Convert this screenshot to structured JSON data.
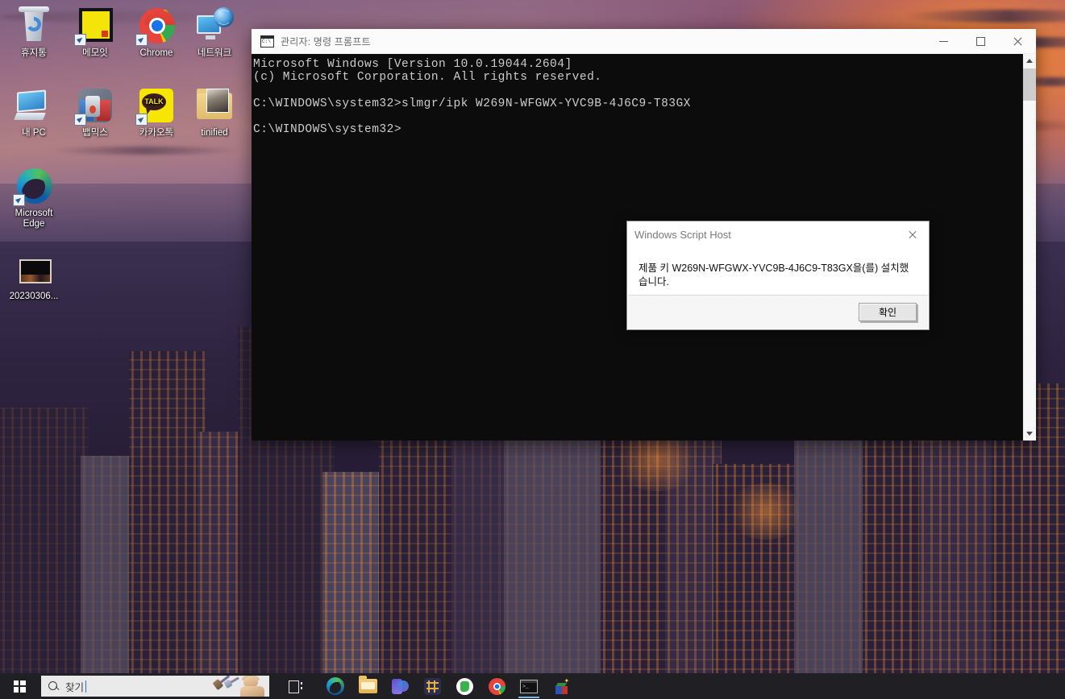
{
  "desktop": {
    "icons": [
      {
        "label": "휴지통",
        "icon": "recycle-bin-icon",
        "shortcut": false
      },
      {
        "label": "메모잇",
        "icon": "memoit-note-icon",
        "shortcut": true
      },
      {
        "label": "Chrome",
        "icon": "chrome-icon",
        "shortcut": true
      },
      {
        "label": "네트워크",
        "icon": "network-icon",
        "shortcut": false
      },
      {
        "label": "내 PC",
        "icon": "this-pc-icon",
        "shortcut": false
      },
      {
        "label": "뱁믹스",
        "icon": "vapmix-icon",
        "shortcut": true
      },
      {
        "label": "카카오톡",
        "icon": "kakaotalk-icon",
        "shortcut": true
      },
      {
        "label": "tinified",
        "icon": "folder-icon",
        "shortcut": false
      },
      {
        "label": "Microsoft Edge",
        "icon": "microsoft-edge-icon",
        "shortcut": true
      },
      {
        "label": "20230306...",
        "icon": "video-file-icon",
        "shortcut": false
      }
    ]
  },
  "console_window": {
    "title": "관리자: 명령 프롬프트",
    "icon": "command-prompt-icon",
    "content": "Microsoft Windows [Version 10.0.19044.2604]\n(c) Microsoft Corporation. All rights reserved.\n\nC:\\WINDOWS\\system32>slmgr/ipk W269N-WFGWX-YVC9B-4J6C9-T83GX\n\nC:\\WINDOWS\\system32>",
    "controls": {
      "minimize": "minimize-button",
      "maximize": "maximize-button",
      "close": "close-button"
    },
    "scrollbar": {
      "up": "scroll-up-arrow",
      "down": "scroll-down-arrow"
    }
  },
  "dialog": {
    "title": "Windows Script Host",
    "message": "제품 키 W269N-WFGWX-YVC9B-4J6C9-T83GX을(를) 설치했습니다.",
    "ok_label": "확인",
    "close": "dialog-close-button"
  },
  "taskbar": {
    "start": "start-button",
    "search": {
      "placeholder": "찾기",
      "value": "찾기"
    },
    "items": [
      {
        "name": "task-view",
        "icon": "task-view-icon"
      },
      {
        "name": "microsoft-edge",
        "icon": "edge-icon"
      },
      {
        "name": "file-explorer",
        "icon": "folder-icon"
      },
      {
        "name": "office",
        "icon": "office-icon"
      },
      {
        "name": "snip-tool",
        "icon": "crop-icon"
      },
      {
        "name": "evernote",
        "icon": "evernote-icon"
      },
      {
        "name": "google-chrome",
        "icon": "chrome-icon"
      },
      {
        "name": "command-prompt",
        "icon": "command-prompt-icon"
      },
      {
        "name": "3d-app",
        "icon": "cube-icon"
      }
    ]
  },
  "colors": {
    "console_bg": "#0c0c0c",
    "console_text": "#cccccc",
    "titlebar_bg": "#fbfbfb",
    "taskbar_bg": "#1f1f24",
    "dialog_bg": "#ffffff",
    "search_bg": "#e8e8e8",
    "accent": "#2b6fd6"
  }
}
